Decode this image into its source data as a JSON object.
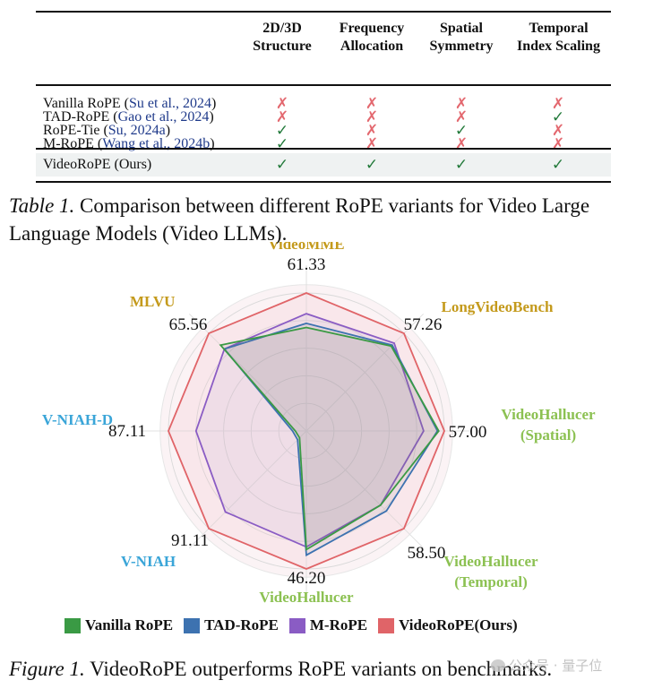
{
  "table": {
    "headers": [
      {
        "line1": "2D/3D",
        "line2": "Structure"
      },
      {
        "line1": "Frequency",
        "line2": "Allocation"
      },
      {
        "line1": "Spatial",
        "line2": "Symmetry"
      },
      {
        "line1": "Temporal",
        "line2": "Index Scaling"
      }
    ],
    "rows": [
      {
        "method": "Vanilla RoPE",
        "citation": "Su et al., 2024",
        "values": [
          "✗",
          "✗",
          "✗",
          "✗"
        ]
      },
      {
        "method": "TAD-RoPE",
        "citation": "Gao et al., 2024",
        "values": [
          "✗",
          "✗",
          "✗",
          "✓"
        ]
      },
      {
        "method": "RoPE-Tie",
        "citation": "Su, 2024a",
        "values": [
          "✓",
          "✗",
          "✓",
          "✗"
        ]
      },
      {
        "method": "M-RoPE",
        "citation": "Wang et al., 2024b",
        "values": [
          "✓",
          "✗",
          "✗",
          "✗"
        ]
      }
    ],
    "ours_row": {
      "method": "VideoRoPE (Ours)",
      "values": [
        "✓",
        "✓",
        "✓",
        "✓"
      ]
    },
    "colors": {
      "check": "#237a3b",
      "cross": "#e3686f",
      "citation": "#1f3a8a",
      "ours_bg": "#eff2f2"
    }
  },
  "table_caption": {
    "label": "Table 1.",
    "text": " Comparison between different RoPE variants for Video Large Language Models (Video LLMs)."
  },
  "chart_data": {
    "type": "radar",
    "title": "",
    "axes": [
      {
        "name": "VideoMME",
        "name_lines": [
          "VideoMME"
        ],
        "max_label": "61.33",
        "color": "#c49a1c"
      },
      {
        "name": "MLVU",
        "name_lines": [
          "MLVU"
        ],
        "max_label": "65.56",
        "color": "#c49a1c"
      },
      {
        "name": "V-NIAH-D",
        "name_lines": [
          "V-NIAH-D"
        ],
        "max_label": "87.11",
        "color": "#3aa5d8"
      },
      {
        "name": "V-NIAH",
        "name_lines": [
          "V-NIAH"
        ],
        "max_label": "91.11",
        "color": "#3aa5d8"
      },
      {
        "name": "VideoHallucer",
        "name_lines": [
          "VideoHallucer"
        ],
        "max_label": "46.20",
        "color": "#8cc152"
      },
      {
        "name": "VideoHallucer (Temporal)",
        "name_lines": [
          "VideoHallucer",
          "(Temporal)"
        ],
        "max_label": "58.50",
        "color": "#8cc152"
      },
      {
        "name": "VideoHallucer (Spatial)",
        "name_lines": [
          "VideoHallucer",
          "(Spatial)"
        ],
        "max_label": "57.00",
        "color": "#8cc152"
      },
      {
        "name": "LongVideoBench",
        "name_lines": [
          "LongVideoBench"
        ],
        "max_label": "57.26",
        "color": "#c49a1c"
      }
    ],
    "value_scale": "fraction of per-axis maximum (VideoRoPE = 1.0)",
    "series": [
      {
        "name": "Vanilla RoPE",
        "color": "#3a9a44",
        "values": [
          0.75,
          0.88,
          0.08,
          0.07,
          0.86,
          0.76,
          0.96,
          0.87
        ]
      },
      {
        "name": "TAD-RoPE",
        "color": "#3d72b0",
        "values": [
          0.78,
          0.84,
          0.1,
          0.09,
          0.9,
          0.82,
          0.95,
          0.88
        ]
      },
      {
        "name": "M-RoPE",
        "color": "#8a5cc4",
        "values": [
          0.85,
          0.84,
          0.8,
          0.83,
          0.84,
          0.76,
          0.85,
          0.9
        ]
      },
      {
        "name": "VideoRoPE(Ours)",
        "color": "#e06468",
        "values": [
          1.0,
          1.0,
          1.0,
          1.0,
          1.0,
          1.0,
          1.0,
          1.0
        ]
      }
    ],
    "grid": true,
    "grid_rings": 5,
    "legend_position": "bottom"
  },
  "figure_caption": {
    "label": "Figure 1.",
    "text": " VideoRoPE outperforms RoPE variants on benchmarks."
  },
  "watermark": {
    "text": "公众号 · 量子位"
  }
}
